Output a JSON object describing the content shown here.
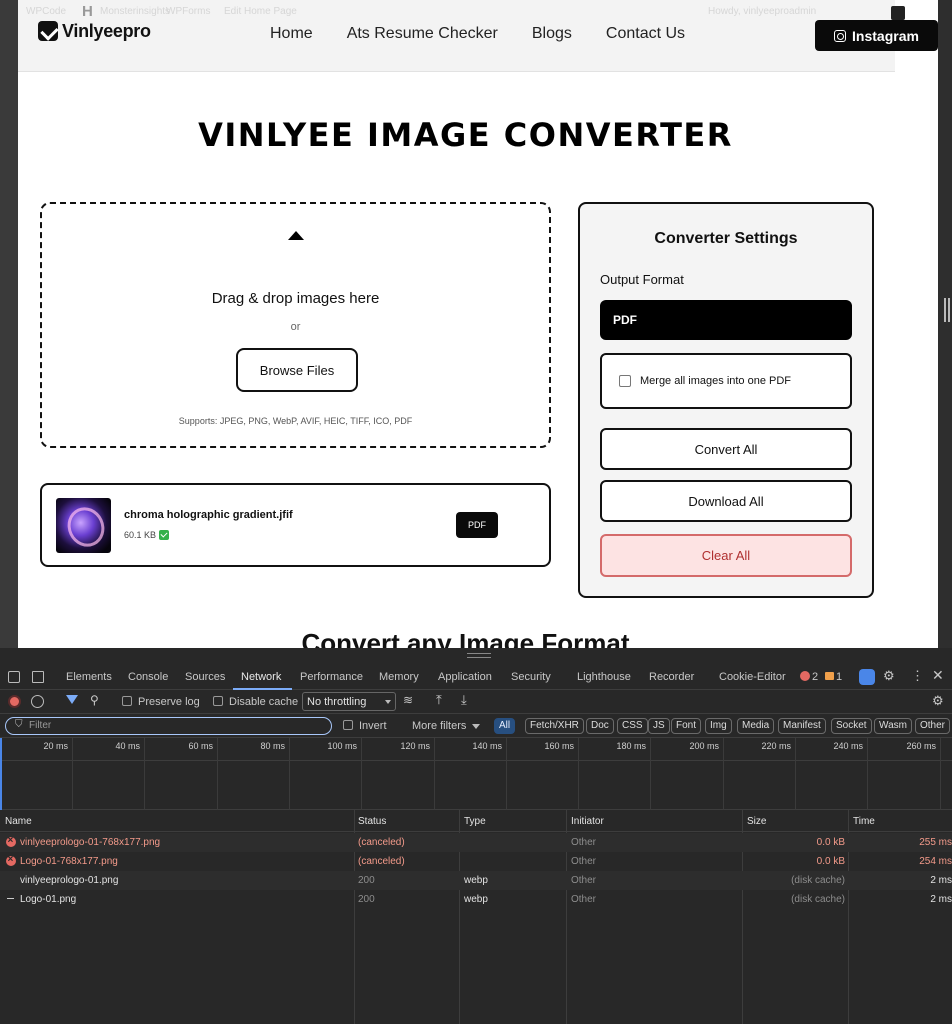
{
  "site": {
    "adminbar": [
      "WPCode",
      "Monsterinsights",
      "WPForms",
      "Edit Home Page",
      "Howdy, vinlyeeproadmin"
    ],
    "logo_text": "Vinlyeepro",
    "nav": [
      "Home",
      "Ats Resume Checker",
      "Blogs",
      "Contact Us"
    ],
    "instagram_label": "Instagram",
    "page_title": "VINLYEE IMAGE CONVERTER",
    "dropzone": {
      "title": "Drag & drop images here",
      "or": "or",
      "browse_label": "Browse Files",
      "supports": "Supports: JPEG, PNG, WebP, AVIF, HEIC, TIFF, ICO, PDF"
    },
    "file": {
      "name": "chroma holographic gradient.jfif",
      "size": "60.1 KB",
      "format": "PDF"
    },
    "settings": {
      "title": "Converter Settings",
      "output_format_label": "Output Format",
      "output_format_value": "PDF",
      "merge_label": "Merge all images into one PDF",
      "convert_all": "Convert All",
      "download_all": "Download All",
      "clear_all": "Clear All"
    },
    "subtitle": "Convert any Image Format"
  },
  "devtools": {
    "tabs": [
      "Elements",
      "Console",
      "Sources",
      "Network",
      "Performance",
      "Memory",
      "Application",
      "Security",
      "Lighthouse",
      "Recorder",
      "Cookie-Editor"
    ],
    "active_tab": "Network",
    "error_count": "2",
    "warning_count": "1",
    "toolbar": {
      "preserve_log": "Preserve log",
      "disable_cache": "Disable cache",
      "throttling": "No throttling"
    },
    "filter": {
      "placeholder": "Filter",
      "invert": "Invert",
      "more_filters": "More filters",
      "types": [
        "All",
        "Fetch/XHR",
        "Doc",
        "CSS",
        "JS",
        "Font",
        "Img",
        "Media",
        "Manifest",
        "Socket",
        "Wasm",
        "Other"
      ]
    },
    "timeline_ticks": [
      "20 ms",
      "40 ms",
      "60 ms",
      "80 ms",
      "100 ms",
      "120 ms",
      "140 ms",
      "160 ms",
      "180 ms",
      "200 ms",
      "220 ms",
      "240 ms",
      "260 ms"
    ],
    "columns": [
      "Name",
      "Status",
      "Type",
      "Initiator",
      "Size",
      "Time"
    ],
    "rows": [
      {
        "name": "vinlyeeprologo-01-768x177.png",
        "status": "(canceled)",
        "type": "",
        "initiator": "Other",
        "size": "0.0 kB",
        "time": "255 ms",
        "state": "error"
      },
      {
        "name": "Logo-01-768x177.png",
        "status": "(canceled)",
        "type": "",
        "initiator": "Other",
        "size": "0.0 kB",
        "time": "254 ms",
        "state": "error"
      },
      {
        "name": "vinlyeeprologo-01.png",
        "status": "200",
        "type": "webp",
        "initiator": "Other",
        "size": "(disk cache)",
        "time": "2 ms",
        "state": "ok"
      },
      {
        "name": "Logo-01.png",
        "status": "200",
        "type": "webp",
        "initiator": "Other",
        "size": "(disk cache)",
        "time": "2 ms",
        "state": "ok"
      }
    ]
  }
}
